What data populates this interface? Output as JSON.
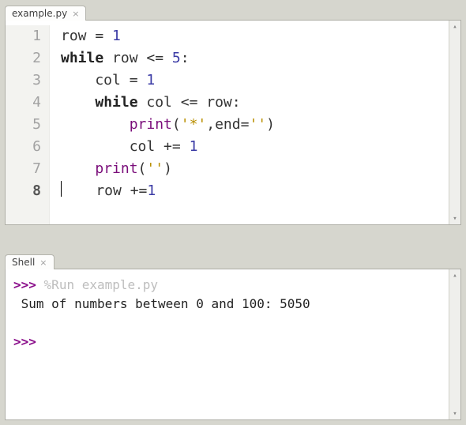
{
  "editor": {
    "tab_label": "example.py",
    "current_line": 8,
    "lines": [
      {
        "n": 1,
        "tokens": [
          [
            "",
            "row = "
          ],
          [
            "num",
            "1"
          ]
        ]
      },
      {
        "n": 2,
        "tokens": [
          [
            "kw",
            "while"
          ],
          [
            "",
            " row <= "
          ],
          [
            "num",
            "5"
          ],
          [
            "",
            ":"
          ]
        ]
      },
      {
        "n": 3,
        "tokens": [
          [
            "",
            "    col = "
          ],
          [
            "num",
            "1"
          ]
        ]
      },
      {
        "n": 4,
        "tokens": [
          [
            "",
            "    "
          ],
          [
            "kw",
            "while"
          ],
          [
            "",
            " col <= row:"
          ]
        ]
      },
      {
        "n": 5,
        "tokens": [
          [
            "",
            "        "
          ],
          [
            "fn",
            "print"
          ],
          [
            "",
            "("
          ],
          [
            "str",
            "'*'"
          ],
          [
            "",
            ",end="
          ],
          [
            "str",
            "''"
          ],
          [
            "",
            ")"
          ]
        ]
      },
      {
        "n": 6,
        "tokens": [
          [
            "",
            "        col += "
          ],
          [
            "num",
            "1"
          ]
        ]
      },
      {
        "n": 7,
        "tokens": [
          [
            "",
            "    "
          ],
          [
            "fn",
            "print"
          ],
          [
            "",
            "("
          ],
          [
            "str",
            "''"
          ],
          [
            "",
            ")"
          ]
        ]
      },
      {
        "n": 8,
        "tokens": [
          [
            "",
            "    row +="
          ],
          [
            "num",
            "1"
          ]
        ]
      }
    ]
  },
  "shell": {
    "tab_label": "Shell",
    "prompt": ">>>",
    "run_cmd": "%Run example.py",
    "output": " Sum of numbers between 0 and 100: 5050"
  }
}
